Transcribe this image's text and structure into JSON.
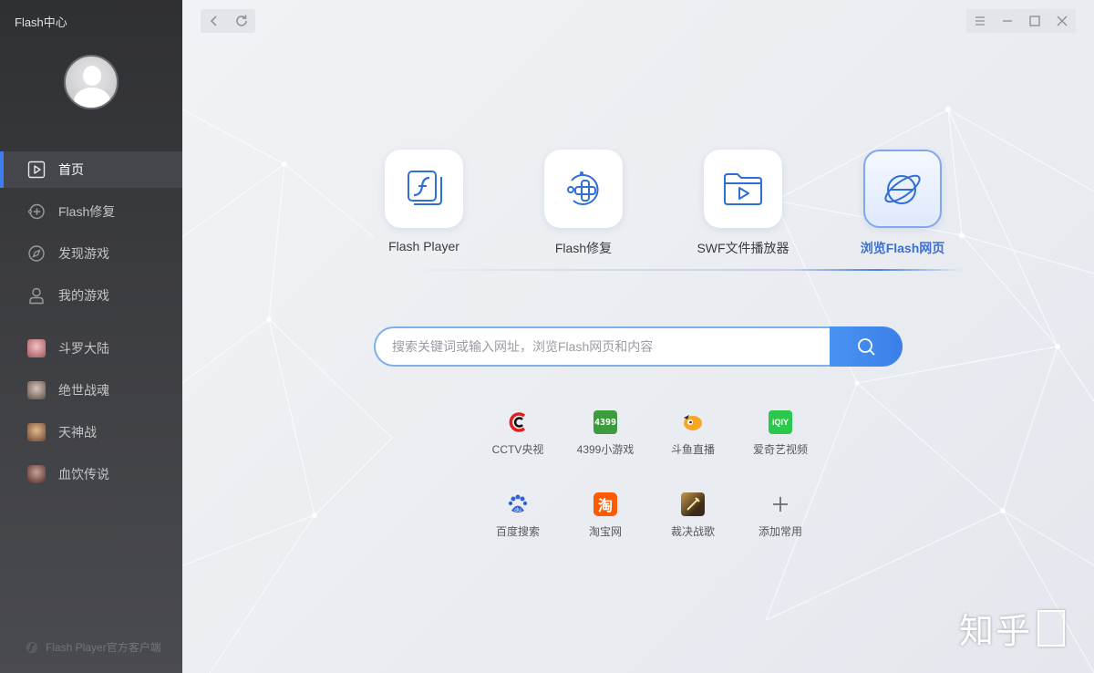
{
  "sidebar": {
    "title": "Flash中心",
    "nav": [
      {
        "label": "首页",
        "icon": "play-square-icon"
      },
      {
        "label": "Flash修复",
        "icon": "repair-icon"
      },
      {
        "label": "发现游戏",
        "icon": "compass-icon"
      },
      {
        "label": "我的游戏",
        "icon": "user-icon"
      }
    ],
    "games": [
      {
        "label": "斗罗大陆",
        "color": "#d48a8e"
      },
      {
        "label": "绝世战魂",
        "color": "#9a7f76"
      },
      {
        "label": "天神战",
        "color": "#b98a63"
      },
      {
        "label": "血饮传说",
        "color": "#8e5d56"
      }
    ],
    "footer": "Flash Player官方客户端"
  },
  "toolbar": {
    "back_icon": "back-arrow-icon",
    "refresh_icon": "refresh-icon"
  },
  "window": {
    "menu_icon": "menu-icon",
    "minimize_icon": "minimize-icon",
    "maximize_icon": "maximize-icon",
    "close_icon": "close-icon"
  },
  "features": [
    {
      "label": "Flash Player",
      "icon": "flash-player-icon"
    },
    {
      "label": "Flash修复",
      "icon": "flash-repair-icon"
    },
    {
      "label": "SWF文件播放器",
      "icon": "swf-folder-icon"
    },
    {
      "label": "浏览Flash网页",
      "icon": "browser-icon",
      "active": true
    }
  ],
  "search": {
    "placeholder": "搜索关键词或输入网址，浏览Flash网页和内容",
    "value": ""
  },
  "sites": [
    {
      "label": "CCTV央视",
      "icon": "cctv-icon"
    },
    {
      "label": "4399小游戏",
      "icon": "4399-icon"
    },
    {
      "label": "斗鱼直播",
      "icon": "douyu-icon"
    },
    {
      "label": "爱奇艺视频",
      "icon": "iqiyi-icon"
    },
    {
      "label": "百度搜索",
      "icon": "baidu-icon"
    },
    {
      "label": "淘宝网",
      "icon": "taobao-icon"
    },
    {
      "label": "裁决战歌",
      "icon": "game-icon"
    },
    {
      "label": "添加常用",
      "icon": "plus-icon"
    }
  ],
  "site_icon_text": {
    "4399": "4399",
    "iqiyi": "iQIY",
    "taobao": "淘",
    "baidu": "du"
  },
  "watermark": "知乎",
  "colors": {
    "accent": "#3d7ef3",
    "sidebar_bg": "#35363a"
  }
}
